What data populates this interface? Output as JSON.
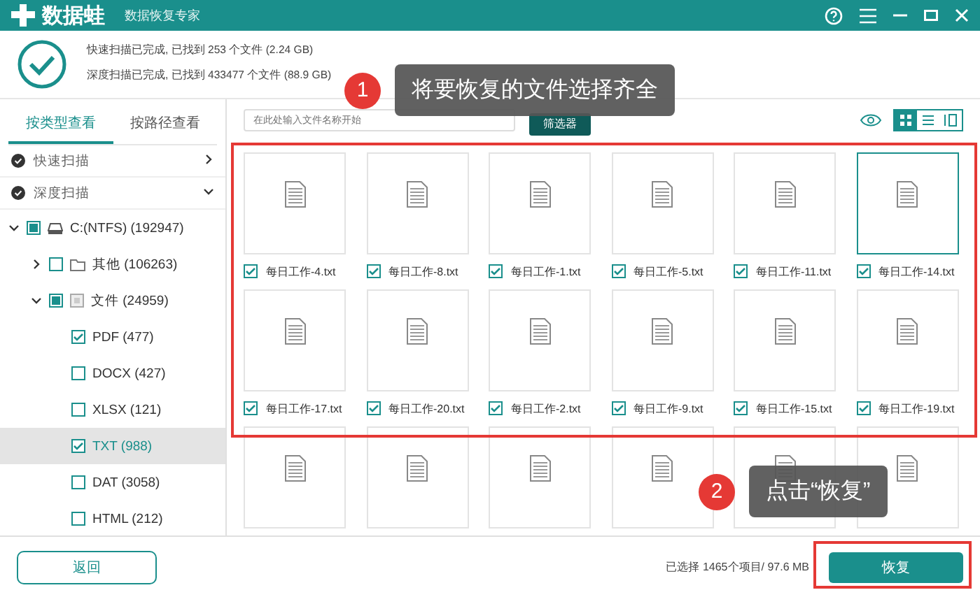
{
  "window": {
    "app_name": "数据蛙",
    "subtitle": "数据恢复专家"
  },
  "scan_summary": [
    "快速扫描已完成, 已找到 253 个文件 (2.24 GB)",
    "深度扫描已完成, 已找到 433477 个文件 (88.9 GB)"
  ],
  "sidebar": {
    "tabs": [
      {
        "label": "按类型查看",
        "selected": true
      },
      {
        "label": "按路径查看",
        "selected": false
      }
    ],
    "scans": [
      {
        "label": "快速扫描",
        "expanded": false
      },
      {
        "label": "深度扫描",
        "expanded": true
      }
    ],
    "tree": [
      {
        "label": "C:(NTFS) (192947)",
        "kind": "drive",
        "checked": false,
        "partial": true,
        "expanded": true,
        "selected": false,
        "children": [
          {
            "label": "其他 (106263)",
            "kind": "folder",
            "checked": false,
            "partial": false,
            "expanded": false,
            "selected": false
          },
          {
            "label": "文件 (24959)",
            "kind": "category",
            "checked": false,
            "partial": true,
            "expanded": true,
            "selected": false,
            "children": [
              {
                "label": "PDF (477)",
                "checked": true,
                "partial": false,
                "selected": false
              },
              {
                "label": "DOCX (427)",
                "checked": false,
                "partial": false,
                "selected": false
              },
              {
                "label": "XLSX (121)",
                "checked": false,
                "partial": false,
                "selected": false
              },
              {
                "label": "TXT (988)",
                "checked": true,
                "partial": false,
                "selected": true
              },
              {
                "label": "DAT (3058)",
                "checked": false,
                "partial": false,
                "selected": false
              },
              {
                "label": "HTML (212)",
                "checked": false,
                "partial": false,
                "selected": false
              }
            ]
          }
        ]
      }
    ]
  },
  "toolbar": {
    "search_placeholder": "在此处输入文件名称开始",
    "filter_button": "筛选器",
    "views": [
      {
        "kind": "grid",
        "selected": true
      },
      {
        "kind": "list",
        "selected": false
      },
      {
        "kind": "detail",
        "selected": false
      }
    ]
  },
  "files": [
    {
      "name": "每日工作-4.txt",
      "checked": true,
      "selected": false
    },
    {
      "name": "每日工作-8.txt",
      "checked": true,
      "selected": false
    },
    {
      "name": "每日工作-1.txt",
      "checked": true,
      "selected": false
    },
    {
      "name": "每日工作-5.txt",
      "checked": true,
      "selected": false
    },
    {
      "name": "每日工作-11.txt",
      "checked": true,
      "selected": false
    },
    {
      "name": "每日工作-14.txt",
      "checked": true,
      "selected": true
    },
    {
      "name": "每日工作-17.txt",
      "checked": true,
      "selected": false
    },
    {
      "name": "每日工作-20.txt",
      "checked": true,
      "selected": false
    },
    {
      "name": "每日工作-2.txt",
      "checked": true,
      "selected": false
    },
    {
      "name": "每日工作-9.txt",
      "checked": true,
      "selected": false
    },
    {
      "name": "每日工作-15.txt",
      "checked": true,
      "selected": false
    },
    {
      "name": "每日工作-19.txt",
      "checked": true,
      "selected": false
    }
  ],
  "clipped_tiles": [
    {
      "kind": "file"
    },
    {
      "kind": "file"
    },
    {
      "kind": "file"
    },
    {
      "kind": "file"
    },
    {
      "kind": "file"
    },
    {
      "kind": "file"
    }
  ],
  "footer": {
    "back_button": "返回",
    "selection_status": "已选择 1465个项目/ 97.6 MB",
    "recover_button": "恢复"
  },
  "callouts": [
    {
      "number": "1",
      "text": "将要恢复的文件选择齐全"
    },
    {
      "number": "2",
      "text": "点击“恢复”"
    }
  ]
}
